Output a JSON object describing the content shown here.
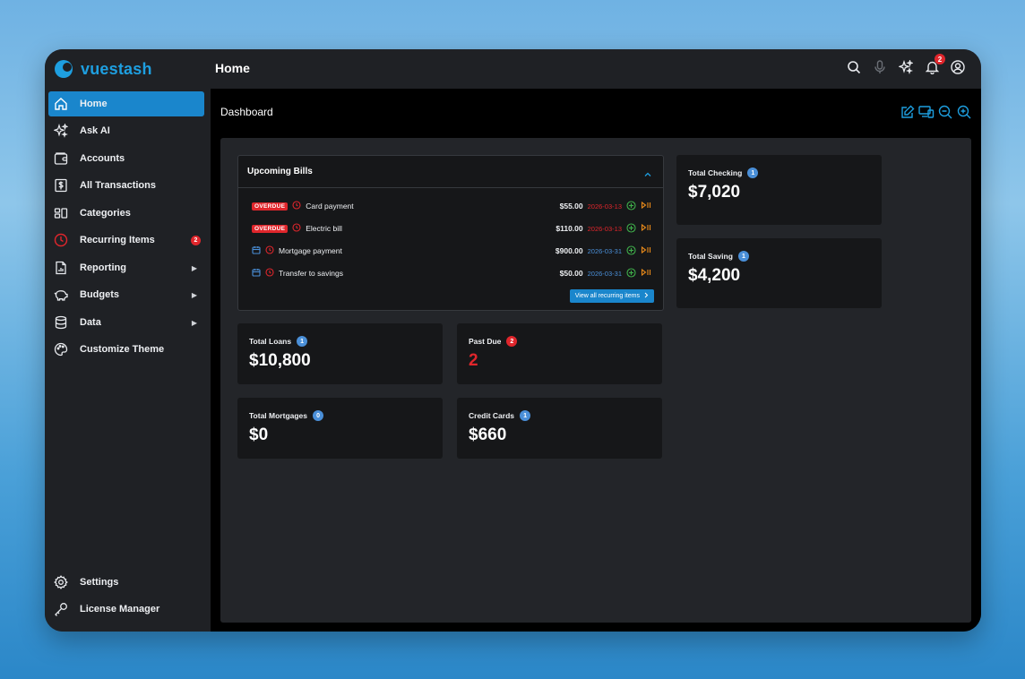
{
  "app": {
    "brand": "vuestash",
    "page_title": "Home",
    "notifications_count": "2"
  },
  "sidebar": {
    "items": [
      {
        "label": "Home",
        "icon": "home-icon",
        "active": true
      },
      {
        "label": "Ask AI",
        "icon": "sparkles-icon"
      },
      {
        "label": "Accounts",
        "icon": "wallet-icon"
      },
      {
        "label": "All Transactions",
        "icon": "dollar-icon"
      },
      {
        "label": "Categories",
        "icon": "categories-icon"
      },
      {
        "label": "Recurring Items",
        "icon": "clock-icon",
        "badge": "2"
      },
      {
        "label": "Reporting",
        "icon": "report-icon",
        "arrow": "▶"
      },
      {
        "label": "Budgets",
        "icon": "piggy-bank-icon",
        "arrow": "▶"
      },
      {
        "label": "Data",
        "icon": "database-icon",
        "arrow": "▶"
      },
      {
        "label": "Customize Theme",
        "icon": "palette-icon"
      }
    ],
    "bottom": [
      {
        "label": "Settings",
        "icon": "gear-icon"
      },
      {
        "label": "License Manager",
        "icon": "key-icon"
      }
    ]
  },
  "dashboard": {
    "title": "Dashboard",
    "upcoming_bills": {
      "title": "Upcoming Bills",
      "rows": [
        {
          "status": "OVERDUE",
          "name": "Card payment",
          "amount": "$55.00",
          "date": "2026-03-13",
          "date_color": "red"
        },
        {
          "status": "OVERDUE",
          "name": "Electric bill",
          "amount": "$110.00",
          "date": "2026-03-13",
          "date_color": "red"
        },
        {
          "status": "",
          "name": "Mortgage payment",
          "amount": "$900.00",
          "date": "2026-03-31",
          "date_color": "blue"
        },
        {
          "status": "",
          "name": "Transfer to savings",
          "amount": "$50.00",
          "date": "2026-03-31",
          "date_color": "blue"
        }
      ],
      "view_all": "View all recurring items"
    },
    "cards": {
      "checking": {
        "title": "Total Checking",
        "badge": "1",
        "value": "$7,020"
      },
      "saving": {
        "title": "Total Saving",
        "badge": "1",
        "value": "$4,200"
      },
      "loans": {
        "title": "Total Loans",
        "badge": "1",
        "value": "$10,800"
      },
      "past_due": {
        "title": "Past Due",
        "badge": "2",
        "value": "2"
      },
      "mortgages": {
        "title": "Total Mortgages",
        "badge": "0",
        "value": "$0"
      },
      "credit_cards": {
        "title": "Credit Cards",
        "badge": "1",
        "value": "$660"
      }
    }
  },
  "colors": {
    "accent": "#1a86cc",
    "danger": "#e0262c",
    "info": "#4a8fd8",
    "success": "#3fae4a",
    "warning": "#e88a1a"
  }
}
